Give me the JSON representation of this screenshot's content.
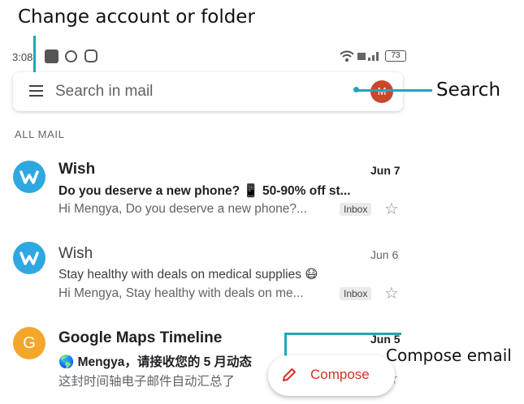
{
  "callouts": {
    "account": "Change account or folder",
    "search": "Search",
    "compose": "Compose email"
  },
  "status_bar": {
    "time": "3:08",
    "battery": "73",
    "icons": [
      "notification-icon",
      "camera-icon",
      "instagram-icon",
      "wifi-icon",
      "signal-icon",
      "battery-icon"
    ]
  },
  "search": {
    "placeholder": "Search in mail",
    "avatar_letter": "M"
  },
  "section_label": "ALL MAIL",
  "emails": [
    {
      "sender": "Wish",
      "subject": "Do you deserve a new phone? 📱 50-90% off st...",
      "snippet": "Hi Mengya, Do you deserve a new phone?...",
      "date": "Jun 7",
      "label": "Inbox",
      "unread": true,
      "avatar": "wish-logo"
    },
    {
      "sender": "Wish",
      "subject": "Stay healthy with deals on medical supplies 😷",
      "snippet": "Hi Mengya, Stay healthy with deals on me...",
      "date": "Jun 6",
      "label": "Inbox",
      "unread": false,
      "avatar": "wish-logo"
    },
    {
      "sender": "Google Maps Timeline",
      "subject": "🌎 Mengya，请接收您的 5 月动态",
      "snippet": "这封时间轴电子邮件自动汇总了",
      "date": "Jun 5",
      "avatar_letter": "G",
      "unread": true
    }
  ],
  "compose": {
    "label": "Compose"
  },
  "colors": {
    "callout_line": "#20a7b5",
    "wish_blue": "#2fa7e0",
    "google_orange": "#f4a62a",
    "compose_red": "#d93025",
    "avatar_red": "#c8482c"
  }
}
